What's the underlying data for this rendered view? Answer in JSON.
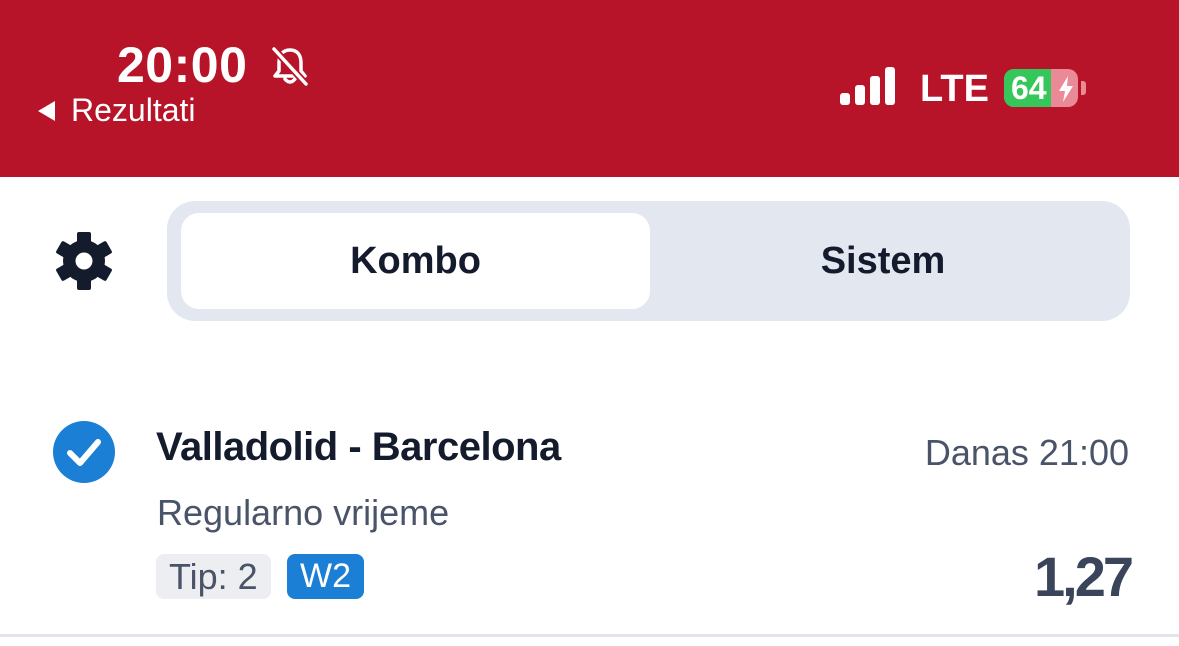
{
  "status_bar": {
    "time": "20:00",
    "back_label": "Rezultati",
    "network": "LTE",
    "battery_level": "64",
    "background_color": "#b71429",
    "icons": [
      "bell-slash-icon",
      "signal-bars-icon",
      "battery-charging-icon"
    ]
  },
  "toolbar": {
    "settings_icon": "gear-icon",
    "tabs": [
      {
        "label": "Kombo",
        "active": true
      },
      {
        "label": "Sistem",
        "active": false
      }
    ]
  },
  "bet": {
    "selected": true,
    "match": "Valladolid - Barcelona",
    "datetime": "Danas 21:00",
    "market": "Regularno vrijeme",
    "tip_label": "Tip: 2",
    "tip_badge": "W2",
    "odds": "1,27",
    "badge_color": "#1b7fd6"
  }
}
